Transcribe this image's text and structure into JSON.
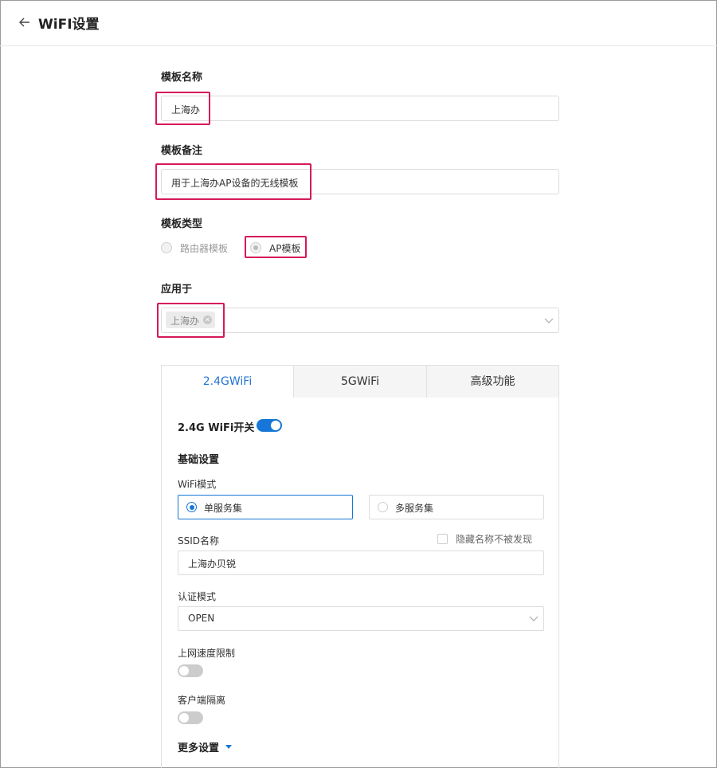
{
  "header": {
    "title": "WiFI设置"
  },
  "form": {
    "template_name_label": "模板名称",
    "template_name_value": "上海办",
    "template_note_label": "模板备注",
    "template_note_value": "用于上海办AP设备的无线模板",
    "template_type_label": "模板类型",
    "template_type_options": [
      "路由器模板",
      "AP模板"
    ],
    "apply_to_label": "应用于",
    "apply_to_tag": "上海办"
  },
  "tabs": [
    "2.4GWiFi",
    "5GWiFi",
    "高级功能"
  ],
  "panel": {
    "switch_label": "2.4G WiFi开关",
    "basic_settings": "基础设置",
    "wifi_mode_label": "WiFi模式",
    "wifi_mode_options": [
      "单服务集",
      "多服务集"
    ],
    "ssid_label": "SSID名称",
    "hide_ssid_label": "隐藏名称不被发现",
    "ssid_value": "上海办贝锐",
    "auth_label": "认证模式",
    "auth_value": "OPEN",
    "speed_limit_label": "上网速度限制",
    "client_isolation_label": "客户端隔离",
    "more_settings": "更多设置"
  },
  "colors": {
    "accent": "#1677d8",
    "highlight": "#d6195b"
  }
}
